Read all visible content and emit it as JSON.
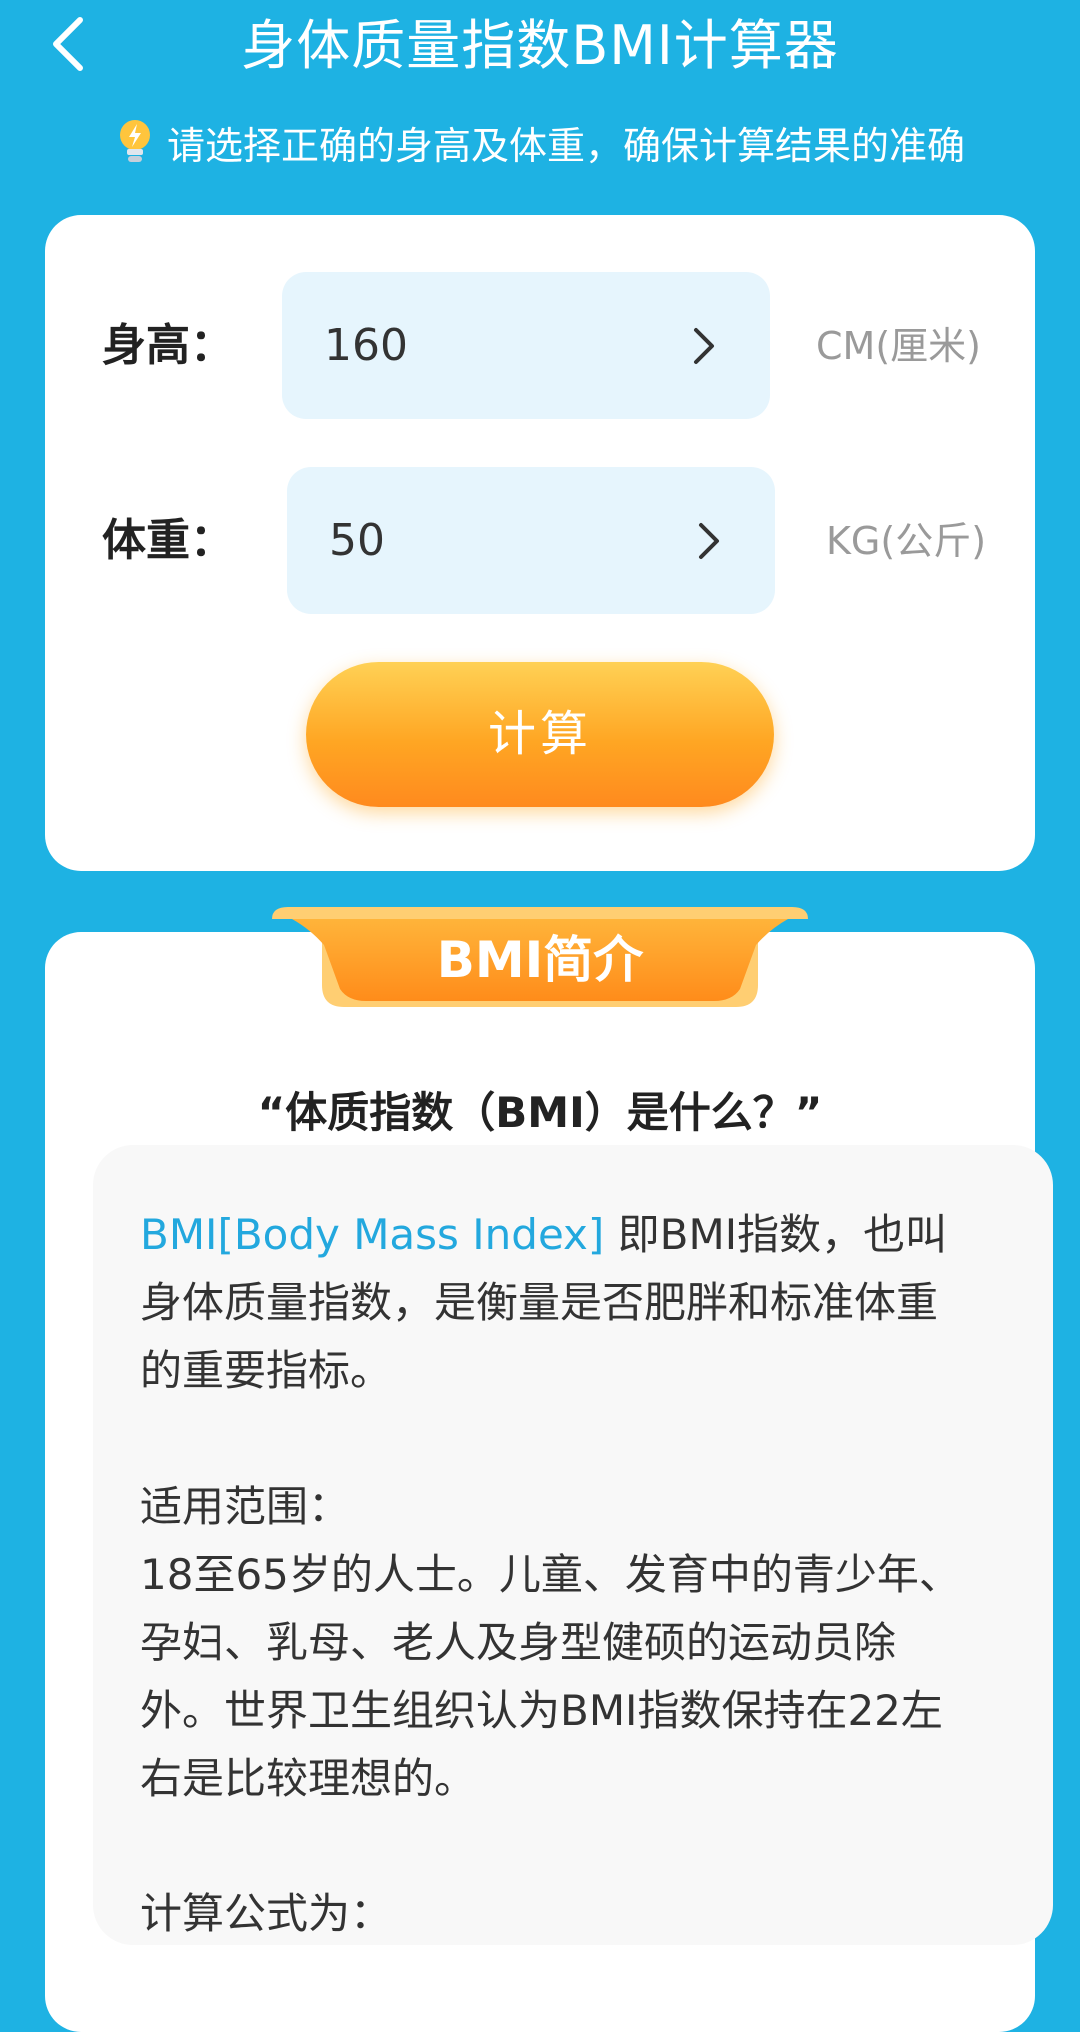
{
  "header": {
    "title": "身体质量指数BMI计算器",
    "back_icon": "chevron-left-icon"
  },
  "tip": {
    "icon": "lightbulb-icon",
    "text": "请选择正确的身高及体重，确保计算结果的准确"
  },
  "form": {
    "height": {
      "label": "身高：",
      "value": "160",
      "unit": "CM(厘米)"
    },
    "weight": {
      "label": "体重：",
      "value": "50",
      "unit": "KG(公斤)"
    },
    "calculate_label": "计算"
  },
  "intro": {
    "ribbon_title": "BMI简介",
    "question": "“体质指数（BMI）是什么？”",
    "highlight": "BMI[Body Mass Index]",
    "definition_line1_rest": " 即BMI指数，也叫",
    "definition_line2": "身体质量指数，是衡量是否肥胖和标准体重",
    "definition_line3": "的重要指标。",
    "scope_title": "适用范围：",
    "scope_line1": "18至65岁的人士。儿童、发育中的青少年、",
    "scope_line2": "孕妇、乳母、老人及身型健硕的运动员除",
    "scope_line3": "外。世界卫生组织认为BMI指数保持在22左",
    "scope_line4": "右是比较理想的。",
    "formula_title": "计算公式为："
  },
  "colors": {
    "background": "#1eb2e3",
    "accent_orange": "#ffa623",
    "field_bg": "#e6f5fd",
    "highlight": "#23a8de"
  }
}
